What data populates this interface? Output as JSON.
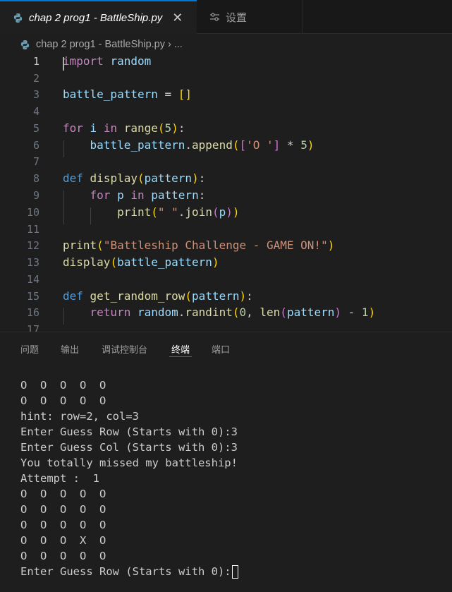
{
  "tabs": {
    "active_title": "chap 2 prog1 - BattleShip.py",
    "close_glyph": "✕",
    "settings_label": "设置"
  },
  "breadcrumb": {
    "file": "chap 2 prog1 - BattleShip.py",
    "sep": "›",
    "more": "..."
  },
  "editor": {
    "line_numbers": [
      "1",
      "2",
      "3",
      "4",
      "5",
      "6",
      "7",
      "8",
      "9",
      "10",
      "11",
      "12",
      "13",
      "14",
      "15",
      "16",
      "17"
    ]
  },
  "panel": {
    "tabs": [
      "问题",
      "输出",
      "调试控制台",
      "终端",
      "端口"
    ],
    "active_tab": "终端"
  },
  "terminal": {
    "lines": [
      "O  O  O  O  O",
      "O  O  O  O  O",
      "hint: row=2, col=3",
      "Enter Guess Row (Starts with 0):3",
      "Enter Guess Col (Starts with 0):3",
      "You totally missed my battleship!",
      "Attempt :  1",
      "O  O  O  O  O",
      "O  O  O  O  O",
      "O  O  O  O  O",
      "O  O  O  X  O",
      "O  O  O  O  O"
    ],
    "prompt": "Enter Guess Row (Starts with 0):"
  },
  "colors": {
    "accent": "#0078d4",
    "background": "#1e1e1e",
    "keyword": "#c586c0",
    "function": "#dcdcaa",
    "variable": "#9cdcfe",
    "string": "#ce9178",
    "number": "#b5cea8"
  }
}
